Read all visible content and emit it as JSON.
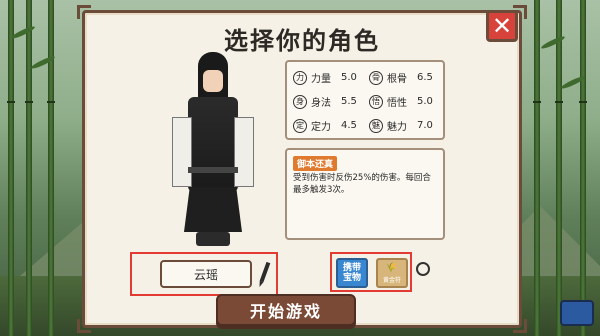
{
  "title": "选择你的角色",
  "close_icon": "close-icon",
  "stats": [
    {
      "icon": "strength-icon",
      "label": "力量",
      "value": "5.0"
    },
    {
      "icon": "root-bone-icon",
      "label": "根骨",
      "value": "6.5"
    },
    {
      "icon": "agility-icon",
      "label": "身法",
      "value": "5.5"
    },
    {
      "icon": "wisdom-icon",
      "label": "悟性",
      "value": "5.0"
    },
    {
      "icon": "focus-icon",
      "label": "定力",
      "value": "4.5"
    },
    {
      "icon": "charm-icon",
      "label": "魅力",
      "value": "7.0"
    }
  ],
  "skill": {
    "tag": "御本还真",
    "description": "受到伤害时反伤25%的伤害。每回合最多触发3次。"
  },
  "name_area": {
    "name": "云瑶",
    "edit_icon": "pencil-icon"
  },
  "items": {
    "carry_label_line1": "携带",
    "carry_label_line2": "宝物",
    "yellow_item_mini_label": "黄金符",
    "refresh_icon": "refresh-icon"
  },
  "start_button": "开始游戏",
  "accent_color": "#7b4a36",
  "highlight_color": "#e23b33"
}
